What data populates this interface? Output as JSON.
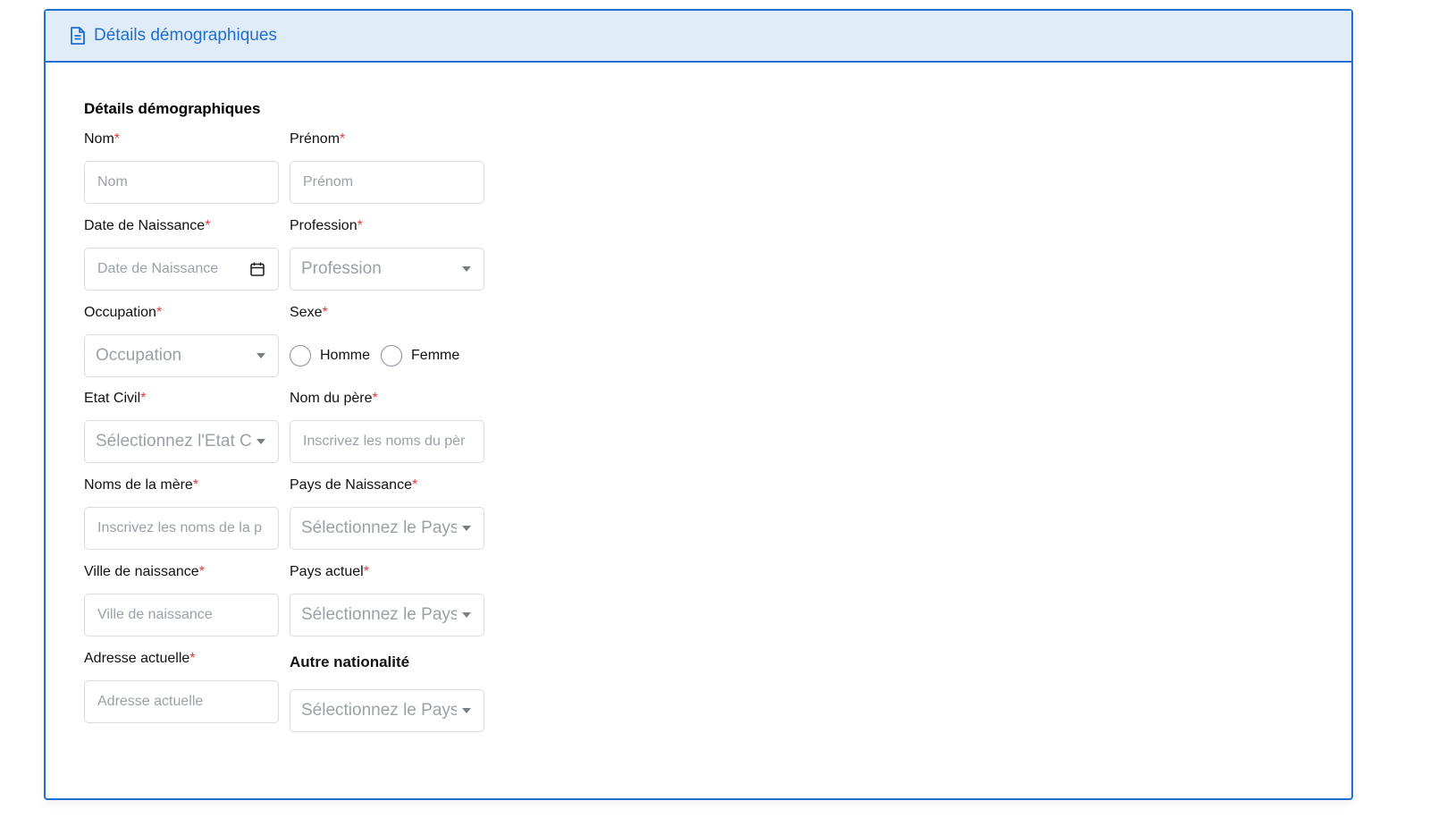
{
  "panel": {
    "header_title": "Détails démographiques",
    "section_title": "Détails démographiques"
  },
  "colors": {
    "accent": "#1f6fd1",
    "header_bg": "#e1ecf9",
    "required": "#e23b3b"
  },
  "fields": {
    "nom": {
      "label": "Nom",
      "required": "*",
      "placeholder": "Nom"
    },
    "prenom": {
      "label": "Prénom",
      "required": "*",
      "placeholder": "Prénom"
    },
    "date_naissance": {
      "label": "Date de Naissance",
      "required": "*",
      "placeholder": "Date de Naissance",
      "icon": "calendar-icon"
    },
    "profession": {
      "label": "Profession",
      "required": "*",
      "placeholder": "Profession"
    },
    "occupation": {
      "label": "Occupation",
      "required": "*",
      "placeholder": "Occupation"
    },
    "sexe": {
      "label": "Sexe",
      "required": "*",
      "options": [
        "Homme",
        "Femme"
      ]
    },
    "etat_civil": {
      "label": "Etat Civil",
      "required": "*",
      "placeholder": "Sélectionnez l'Etat C"
    },
    "nom_pere": {
      "label": "Nom du père",
      "required": "*",
      "placeholder": "Inscrivez les noms du pèr"
    },
    "noms_mere": {
      "label": "Noms de la mère",
      "required": "*",
      "placeholder": "Inscrivez les noms de la p"
    },
    "pays_naissance": {
      "label": "Pays de Naissance",
      "required": "*",
      "placeholder": "Sélectionnez le Pays"
    },
    "ville_naissance": {
      "label": "Ville de naissance",
      "required": "*",
      "placeholder": "Ville de naissance"
    },
    "pays_actuel": {
      "label": "Pays actuel",
      "required": "*",
      "placeholder": "Sélectionnez le Pays"
    },
    "adresse_actuelle": {
      "label": "Adresse actuelle",
      "required": "*",
      "placeholder": "Adresse actuelle"
    },
    "autre_nationalite": {
      "label": "Autre nationalité",
      "placeholder": "Sélectionnez le Pays"
    }
  }
}
